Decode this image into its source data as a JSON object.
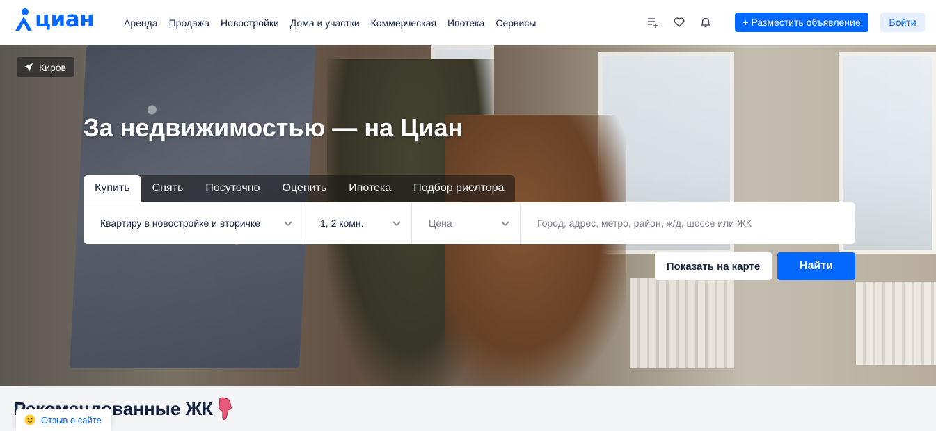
{
  "header": {
    "logo_text": "циан",
    "nav": [
      "Аренда",
      "Продажа",
      "Новостройки",
      "Дома и участки",
      "Коммерческая",
      "Ипотека",
      "Сервисы"
    ],
    "icons": [
      "compare-list-icon",
      "heart-icon",
      "bell-icon"
    ],
    "post_button": "+ Разместить объявление",
    "login_button": "Войти"
  },
  "hero": {
    "location": "Киров",
    "title": "За недвижимостью — на Циан",
    "tabs": [
      "Купить",
      "Снять",
      "Посуточно",
      "Оценить",
      "Ипотека",
      "Подбор риелтора"
    ],
    "active_tab": 0,
    "search": {
      "type_value": "Квартиру в новостройке и вторичке",
      "rooms_value": "1, 2 комн.",
      "price_placeholder": "Цена",
      "geo_placeholder": "Город, адрес, метро, район, ж/д, шоссе или ЖК"
    },
    "map_button": "Показать на карте",
    "find_button": "Найти"
  },
  "recommended": {
    "title": "Рекомендованные ЖК",
    "feedback_label": "Отзыв о сайте"
  },
  "colors": {
    "accent": "#0468ff",
    "accent_light": "#e5efff",
    "text": "#152242"
  }
}
